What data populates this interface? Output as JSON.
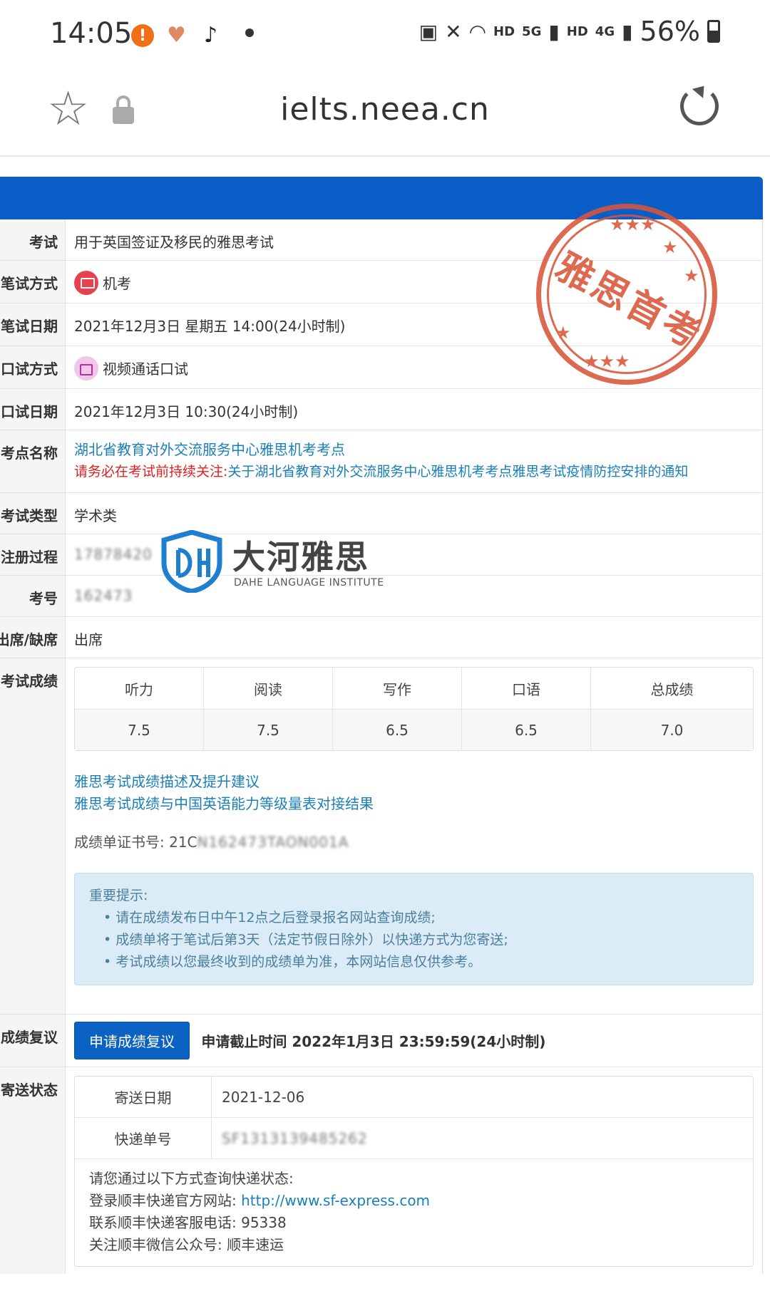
{
  "status_bar": {
    "time": "14:05",
    "notification_icons": [
      "alert-icon",
      "health-icon",
      "tiktok-icon"
    ],
    "network": [
      "HD",
      "5G",
      "HD",
      "4G"
    ],
    "battery": "56%"
  },
  "browser": {
    "url": "ielts.neea.cn"
  },
  "result": {
    "labels": {
      "exam": "考试",
      "written_mode": "笔试方式",
      "written_date": "笔试日期",
      "oral_mode": "口试方式",
      "oral_date": "口试日期",
      "center_name": "考点名称",
      "exam_type": "考试类型",
      "registration": "注册过程)",
      "candidate_no": "考号",
      "attendance": "出席/缺席",
      "scores": "考试成绩",
      "review": "成绩复议",
      "shipping": "寄送状态"
    },
    "exam": "用于英国签证及移民的雅思考试",
    "written_mode": "机考",
    "written_date": "2021年12月3日 星期五 14:00(24小时制)",
    "oral_mode": "视频通话口试",
    "oral_date": "2021年12月3日 10:30(24小时制)",
    "center_name": "湖北省教育对外交流服务中心雅思机考考点",
    "center_warning": "请务必在考试前持续关注:",
    "center_notice_link": "关于湖北省教育对外交流服务中心雅思机考考点雅思考试疫情防控安排的通知",
    "exam_type": "学术类",
    "registration_value": "17878420",
    "candidate_no_value": "162473",
    "attendance": "出席",
    "score_headers": [
      "听力",
      "阅读",
      "写作",
      "口语",
      "总成绩"
    ],
    "score_values": [
      "7.5",
      "7.5",
      "6.5",
      "6.5",
      "7.0"
    ],
    "links": [
      "雅思考试成绩描述及提升建议",
      "雅思考试成绩与中国英语能力等级量表对接结果"
    ],
    "trf_label": "成绩单证书号: 21C",
    "trf_value": "N162473TAON001A",
    "notice_title": "重要提示:",
    "notice_items": [
      "请在成绩发布日中午12点之后登录报名网站查询成绩;",
      "成绩单将于笔试后第3天（法定节假日除外）以快递方式为您寄送;",
      "考试成绩以您最终收到的成绩单为准，本网站信息仅供参考。"
    ],
    "review_button": "申请成绩复议",
    "review_deadline": "申请截止时间 2022年1月3日 23:59:59(24小时制)",
    "ship_date_label": "寄送日期",
    "ship_date": "2021-12-06",
    "tracking_label": "快递单号",
    "tracking_no": "SF1313139485262",
    "ship_info_title": "请您通过以下方式查询快递状态:",
    "ship_info_site_label": "登录顺丰快递官方网站: ",
    "ship_info_site_url": "http://www.sf-express.com",
    "ship_info_phone": "联系顺丰快递客服电话: 95338",
    "ship_info_wechat": "关注顺丰微信公众号: 顺丰速运"
  },
  "stamp": {
    "text": "雅思首考",
    "color": "#d9553a"
  },
  "watermark": {
    "title": "大河雅思",
    "subtitle": "DAHE LANGUAGE INSTITUTE",
    "color": "#1e7fd0"
  },
  "colors": {
    "accent": "#0b5ec8",
    "link": "#1a7fb8",
    "warning": "#e02020"
  }
}
